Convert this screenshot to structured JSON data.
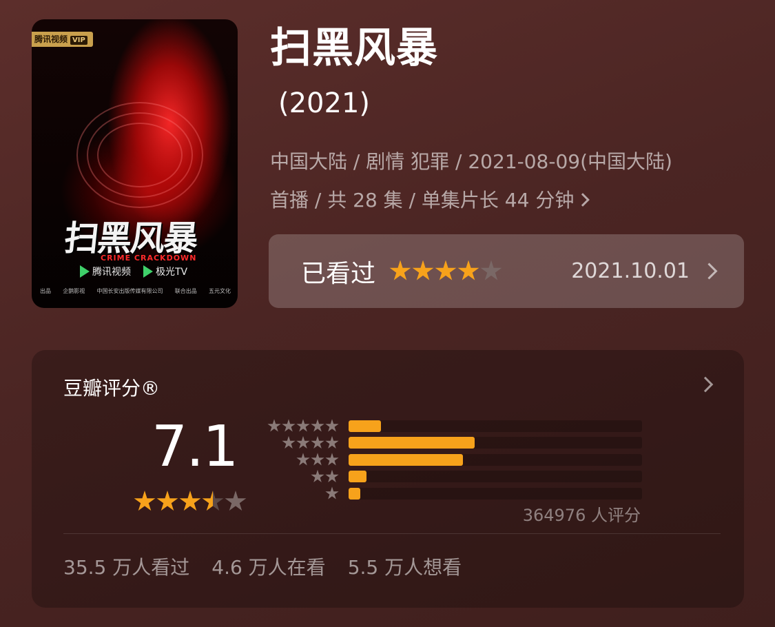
{
  "poster": {
    "badge_text": "腾讯视频",
    "badge_vip": "VIP",
    "title_art": "扫黑风暴",
    "subtitle_art": "CRIME CRACKDOWN",
    "platform_1": "腾讯视频",
    "platform_2": "极光TV",
    "credit_1": "出品",
    "credit_2": "企鹅影视",
    "credit_3": "中国长安出版传媒有限公司",
    "credit_4": "联合出品",
    "credit_5": "五元文化"
  },
  "show": {
    "title": "扫黑风暴",
    "year": "(2021)",
    "meta_line_1": "中国大陆 / 剧情 犯罪 / 2021-08-09(中国大陆)",
    "meta_line_2": "首播 / 共 28 集 / 单集片长 44 分钟"
  },
  "watched": {
    "label": "已看过",
    "user_rating_stars": 4,
    "date": "2021.10.01"
  },
  "douban": {
    "title": "豆瓣评分®",
    "score": "7.1",
    "score_stars": 3.5,
    "rating_count": "364976 人评分",
    "distribution": [
      {
        "stars": 5,
        "fraction": 0.11
      },
      {
        "stars": 4,
        "fraction": 0.43
      },
      {
        "stars": 3,
        "fraction": 0.39
      },
      {
        "stars": 2,
        "fraction": 0.06
      },
      {
        "stars": 1,
        "fraction": 0.04
      }
    ],
    "stats": {
      "watched": "35.5 万人看过",
      "watching": "4.6 万人在看",
      "want": "5.5 万人想看"
    }
  },
  "colors": {
    "star_on": "#f7a21b",
    "star_off": "#5c4a48",
    "background": "#4b2523"
  }
}
